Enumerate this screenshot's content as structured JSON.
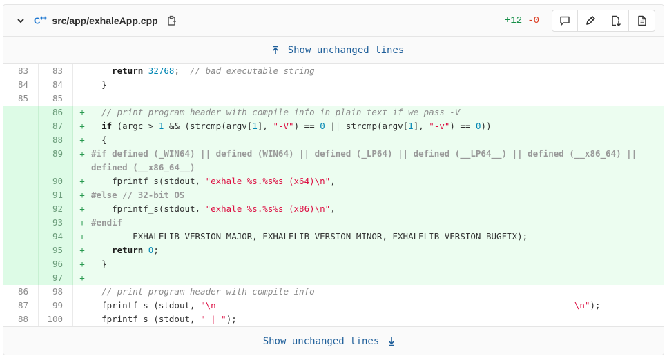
{
  "file": {
    "lang_icon": "cpp-icon",
    "path": "src/app/exhaleApp.cpp",
    "additions": "+12",
    "deletions": "-0"
  },
  "expand_top": {
    "label": "Show unchanged lines"
  },
  "expand_bottom": {
    "label": "Show unchanged lines"
  },
  "icons": [
    "chevron-down-icon",
    "copy-icon",
    "comment-icon",
    "pencil-icon",
    "file-download-icon",
    "view-file-icon",
    "arrow-up-icon",
    "arrow-down-icon"
  ],
  "lines": [
    {
      "old": "83",
      "new": "83",
      "sign": "",
      "type": "ctx"
    },
    {
      "old": "84",
      "new": "84",
      "sign": "",
      "type": "ctx"
    },
    {
      "old": "85",
      "new": "85",
      "sign": "",
      "type": "ctx"
    },
    {
      "old": "",
      "new": "86",
      "sign": "+",
      "type": "add"
    },
    {
      "old": "",
      "new": "87",
      "sign": "+",
      "type": "add"
    },
    {
      "old": "",
      "new": "88",
      "sign": "+",
      "type": "add"
    },
    {
      "old": "",
      "new": "89",
      "sign": "+",
      "type": "add"
    },
    {
      "old": "",
      "new": "90",
      "sign": "+",
      "type": "add"
    },
    {
      "old": "",
      "new": "91",
      "sign": "+",
      "type": "add"
    },
    {
      "old": "",
      "new": "92",
      "sign": "+",
      "type": "add"
    },
    {
      "old": "",
      "new": "93",
      "sign": "+",
      "type": "add"
    },
    {
      "old": "",
      "new": "94",
      "sign": "+",
      "type": "add"
    },
    {
      "old": "",
      "new": "95",
      "sign": "+",
      "type": "add"
    },
    {
      "old": "",
      "new": "96",
      "sign": "+",
      "type": "add"
    },
    {
      "old": "",
      "new": "97",
      "sign": "+",
      "type": "add"
    },
    {
      "old": "86",
      "new": "98",
      "sign": "",
      "type": "ctx"
    },
    {
      "old": "87",
      "new": "99",
      "sign": "",
      "type": "ctx"
    },
    {
      "old": "88",
      "new": "100",
      "sign": "",
      "type": "ctx"
    }
  ],
  "code": {
    "l83": {
      "kw": "return",
      "num": "32768",
      "semi": ";",
      "cm": "// bad executable string"
    },
    "l84": "}",
    "l86": "// print program header with compile info in plain text if we pass -V",
    "l87": {
      "kw": "if",
      "a": "(argc > ",
      "n1": "1",
      "b": " && (strcmp(argv[",
      "n2": "1",
      "c": "], ",
      "s1": "\"-V\"",
      "d": ") == ",
      "n3": "0",
      "e": " || strcmp(argv[",
      "n4": "1",
      "f": "], ",
      "s2": "\"-v\"",
      "g": ") == ",
      "n5": "0",
      "h": "))"
    },
    "l88": "{",
    "l89": "#if defined (_WIN64) || defined (WIN64) || defined (_LP64) || defined (__LP64__) || defined (__x86_64) ||\ndefined (__x86_64__)",
    "l90": {
      "a": "fprintf_s(stdout, ",
      "s": "\"exhale %s.%s%s (x64)\\n\"",
      "b": ","
    },
    "l91": "#else // 32-bit OS",
    "l92": {
      "a": "fprintf_s(stdout, ",
      "s": "\"exhale %s.%s%s (x86)\\n\"",
      "b": ","
    },
    "l93": "#endif",
    "l94": "EXHALELIB_VERSION_MAJOR, EXHALELIB_VERSION_MINOR, EXHALELIB_VERSION_BUGFIX);",
    "l95": {
      "kw": "return",
      "num": "0",
      "semi": ";"
    },
    "l96": "}",
    "l98": "// print program header with compile info",
    "l99": {
      "a": "fprintf_s (stdout, ",
      "s": "\"\\n  -------------------------------------------------------------------\\n\"",
      "b": ");"
    },
    "l100": {
      "a": "fprintf_s (stdout, ",
      "s": "\" | \"",
      "b": ");"
    }
  },
  "colors": {
    "added_bg": "#ecfdf0",
    "added_gutter": "#ddfbe6",
    "link": "#1f5f9a",
    "additions": "#168f48",
    "deletions": "#db3b21"
  }
}
